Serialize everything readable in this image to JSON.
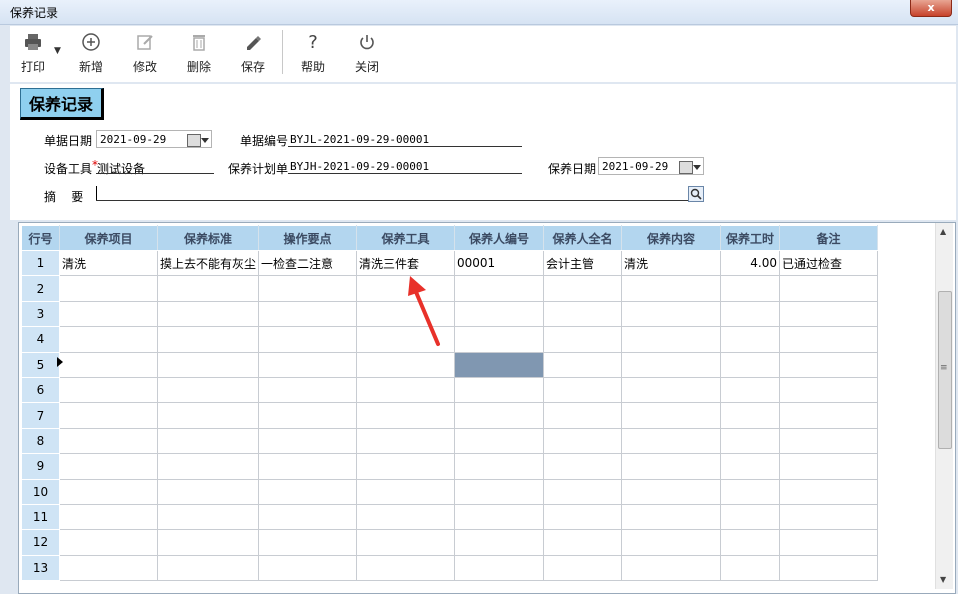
{
  "window": {
    "title": "保养记录",
    "close_label": "x"
  },
  "toolbar": {
    "print": "打印",
    "add": "新增",
    "edit": "修改",
    "delete": "删除",
    "save": "保存",
    "help": "帮助",
    "close": "关闭"
  },
  "form": {
    "section_title": "保养记录",
    "doc_date_label": "单据日期",
    "doc_date": "2021-09-29",
    "doc_no_label": "单据编号",
    "doc_no": "BYJL-2021-09-29-00001",
    "tool_label": "设备工具",
    "required_mark": "*",
    "tool_value": "测试设备",
    "plan_label": "保养计划单",
    "plan_value": "BYJH-2021-09-29-00001",
    "maint_date_label": "保养日期",
    "maint_date": "2021-09-29",
    "summary_label": "摘    要"
  },
  "table": {
    "columns": [
      "行号",
      "保养项目",
      "保养标准",
      "操作要点",
      "保养工具",
      "保养人编号",
      "保养人全名",
      "保养内容",
      "保养工时",
      "备注"
    ],
    "rows": [
      [
        "1",
        "清洗",
        "摸上去不能有灰尘",
        "一检查二注意",
        "清洗三件套",
        "00001",
        "会计主管",
        "清洗",
        "4.00",
        "已通过检查"
      ],
      [
        "2",
        "",
        "",
        "",
        "",
        "",
        "",
        "",
        "",
        ""
      ],
      [
        "3",
        "",
        "",
        "",
        "",
        "",
        "",
        "",
        "",
        ""
      ],
      [
        "4",
        "",
        "",
        "",
        "",
        "",
        "",
        "",
        "",
        ""
      ],
      [
        "5",
        "",
        "",
        "",
        "",
        "",
        "",
        "",
        "",
        ""
      ],
      [
        "6",
        "",
        "",
        "",
        "",
        "",
        "",
        "",
        "",
        ""
      ],
      [
        "7",
        "",
        "",
        "",
        "",
        "",
        "",
        "",
        "",
        ""
      ],
      [
        "8",
        "",
        "",
        "",
        "",
        "",
        "",
        "",
        "",
        ""
      ],
      [
        "9",
        "",
        "",
        "",
        "",
        "",
        "",
        "",
        "",
        ""
      ],
      [
        "10",
        "",
        "",
        "",
        "",
        "",
        "",
        "",
        "",
        ""
      ],
      [
        "11",
        "",
        "",
        "",
        "",
        "",
        "",
        "",
        "",
        ""
      ],
      [
        "12",
        "",
        "",
        "",
        "",
        "",
        "",
        "",
        "",
        ""
      ],
      [
        "13",
        "",
        "",
        "",
        "",
        "",
        "",
        "",
        "",
        ""
      ]
    ]
  },
  "scrollbar": {
    "grip": "≡"
  },
  "colors": {
    "header_bg": "#b3d6ef",
    "selected_cell": "#8097b1",
    "arrow": "#e8312a",
    "section_title_bg": "#8fd0ef"
  }
}
